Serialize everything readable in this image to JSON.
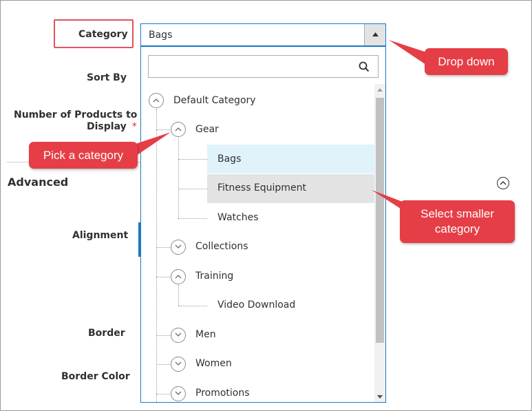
{
  "form": {
    "category_label": "Category",
    "sort_by_label": "Sort By",
    "num_products_label_line1": "Number of Products to",
    "num_products_label_line2": "Display",
    "required_marker": "*",
    "advanced_title": "Advanced",
    "alignment_label": "Alignment",
    "border_label": "Border",
    "border_color_label": "Border Color"
  },
  "category_select": {
    "selected_value": "Bags",
    "search_placeholder": "",
    "search_value": ""
  },
  "category_tree": [
    {
      "label": "Default Category",
      "level": 0,
      "state": "expanded"
    },
    {
      "label": "Gear",
      "level": 1,
      "state": "expanded"
    },
    {
      "label": "Bags",
      "level": 2,
      "state": "selected"
    },
    {
      "label": "Fitness Equipment",
      "level": 2,
      "state": "hover"
    },
    {
      "label": "Watches",
      "level": 2,
      "state": "leaf"
    },
    {
      "label": "Collections",
      "level": 1,
      "state": "collapsed"
    },
    {
      "label": "Training",
      "level": 1,
      "state": "expanded"
    },
    {
      "label": "Video Download",
      "level": 2,
      "state": "leaf"
    },
    {
      "label": "Men",
      "level": 1,
      "state": "collapsed"
    },
    {
      "label": "Women",
      "level": 1,
      "state": "collapsed"
    },
    {
      "label": "Promotions",
      "level": 1,
      "state": "collapsed"
    }
  ],
  "callouts": {
    "drop_down": "Drop down",
    "pick_category": "Pick a category",
    "select_smaller_line1": "Select smaller",
    "select_smaller_line2": "category"
  },
  "colors": {
    "callout": "#e53e46",
    "focus_border": "#1979c3",
    "selected_row": "#e0f3fb",
    "hover_row": "#e3e3e3",
    "required": "#e22626"
  },
  "icons": {
    "search": "search-icon",
    "dropdown_arrow": "triangle-up-icon",
    "expanded": "chevron-up-icon",
    "collapsed": "chevron-down-icon"
  }
}
